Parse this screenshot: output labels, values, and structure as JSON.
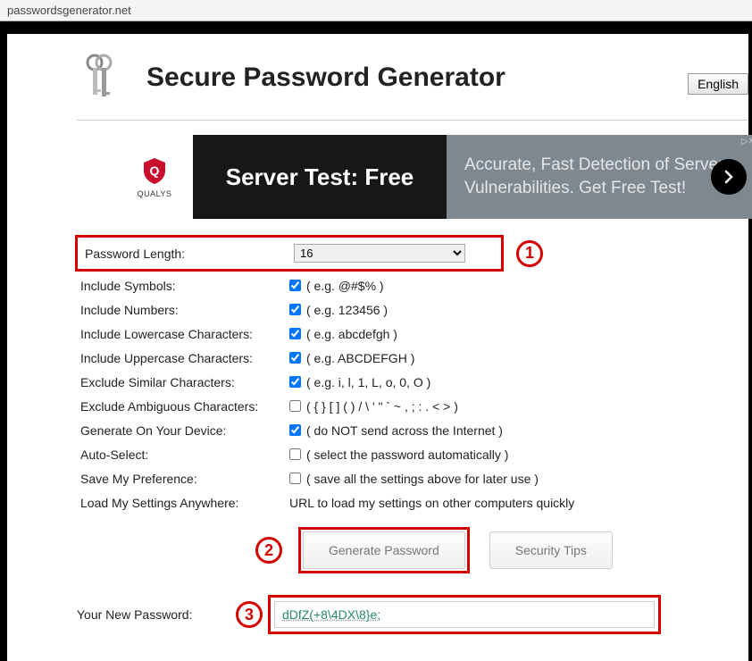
{
  "addressBar": "passwordsgenerator.net",
  "header": {
    "title": "Secure Password Generator",
    "language": "English"
  },
  "ad": {
    "brand": "QUALYS",
    "mid": "Server Test: Free",
    "right": "Accurate, Fast Detection of Server Vulnerabilities. Get Free Test!"
  },
  "annotations": {
    "c1": "1",
    "c2": "2",
    "c3": "3"
  },
  "options": {
    "passwordLength": {
      "label": "Password Length:",
      "value": "16"
    },
    "includeSymbols": {
      "label": "Include Symbols:",
      "checked": true,
      "hint": "( e.g. @#$% )"
    },
    "includeNumbers": {
      "label": "Include Numbers:",
      "checked": true,
      "hint": "( e.g. 123456 )"
    },
    "includeLower": {
      "label": "Include Lowercase Characters:",
      "checked": true,
      "hint": "( e.g. abcdefgh )"
    },
    "includeUpper": {
      "label": "Include Uppercase Characters:",
      "checked": true,
      "hint": "( e.g. ABCDEFGH )"
    },
    "excludeSimilar": {
      "label": "Exclude Similar Characters:",
      "checked": true,
      "hint": "( e.g. i, l, 1, L, o, 0, O )"
    },
    "excludeAmbiguous": {
      "label": "Exclude Ambiguous Characters:",
      "checked": false,
      "hint": "( { } [ ] ( ) / \\ ' \" ` ~ , ; : . < > )"
    },
    "generateLocal": {
      "label": "Generate On Your Device:",
      "checked": true,
      "hint": "( do NOT send across the Internet )"
    },
    "autoSelect": {
      "label": "Auto-Select:",
      "checked": false,
      "hint": "( select the password automatically )"
    },
    "savePref": {
      "label": "Save My Preference:",
      "checked": false,
      "hint": "( save all the settings above for later use )"
    },
    "loadSettings": {
      "label": "Load My Settings Anywhere:",
      "text": "URL to load my settings on other computers quickly"
    }
  },
  "buttons": {
    "generate": "Generate Password",
    "tips": "Security Tips"
  },
  "result": {
    "label": "Your New Password:",
    "value": "dDfZ(+8\\4DX\\8}e;"
  }
}
